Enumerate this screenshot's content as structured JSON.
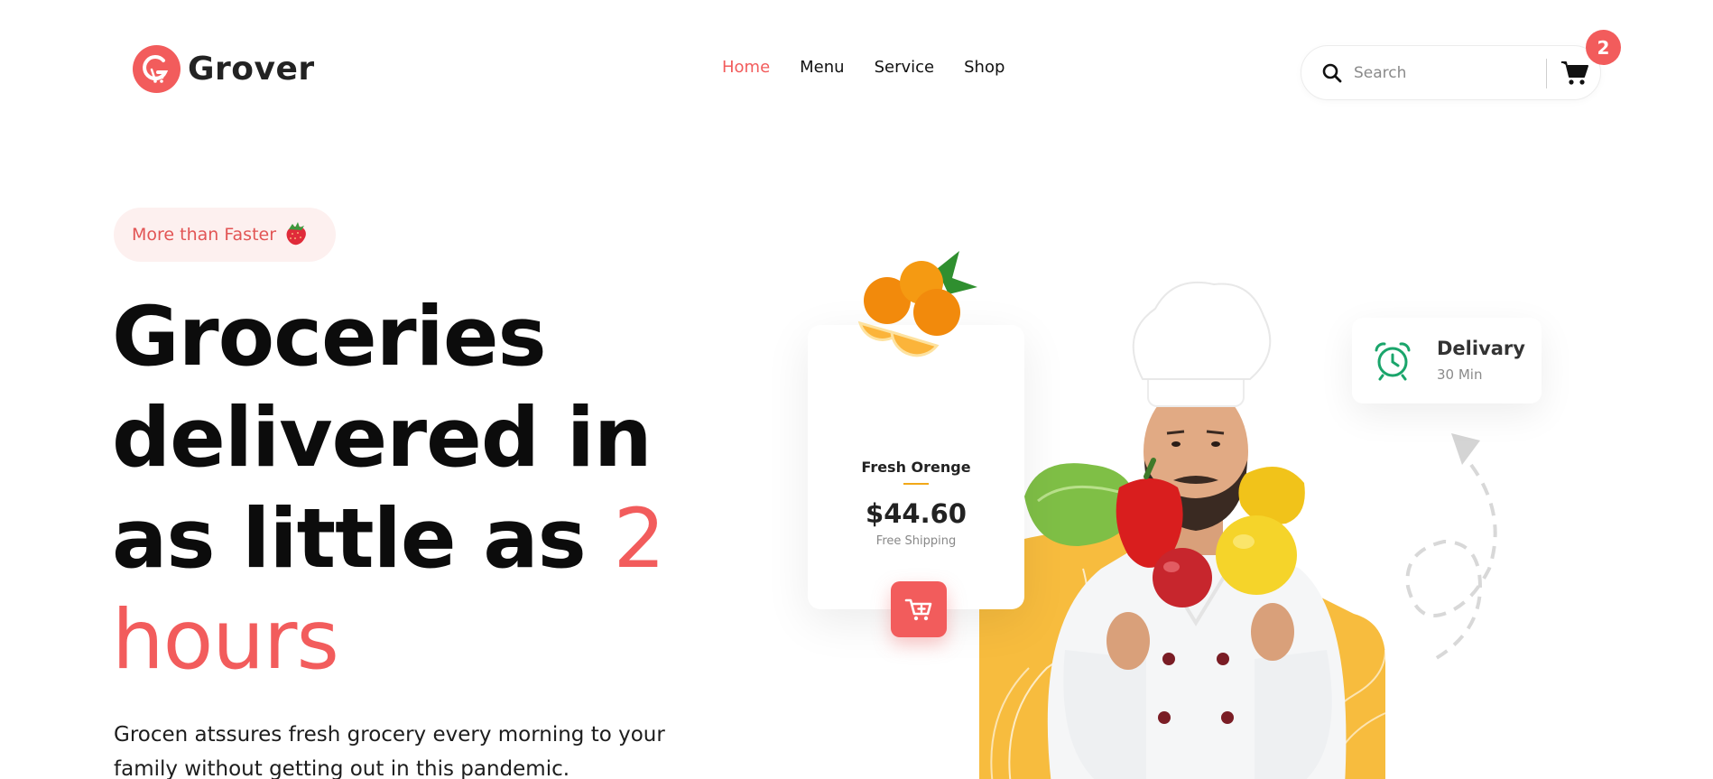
{
  "brand": {
    "name": "Grover",
    "accent_color": "#f25c5c",
    "logo_icon": "grover-g-cart-icon"
  },
  "nav": {
    "items": [
      {
        "label": "Home",
        "active": true
      },
      {
        "label": "Menu",
        "active": false
      },
      {
        "label": "Service",
        "active": false
      },
      {
        "label": "Shop",
        "active": false
      }
    ]
  },
  "search": {
    "placeholder": "Search",
    "value": "",
    "icon": "search-icon"
  },
  "cart": {
    "count": "2",
    "icon": "cart-icon"
  },
  "hero": {
    "tagline": "More than Faster",
    "tagline_icon": "strawberry-icon",
    "headline": {
      "line1": "Groceries",
      "line2": "delivered in",
      "line3_pre": "as little as ",
      "line3_accent": "2",
      "line4_accent": "hours"
    },
    "description": "Grocen atssures fresh grocery every morning to your family without getting out in this pandemic."
  },
  "product_card": {
    "name": "Fresh Orenge",
    "price": "$44.60",
    "shipping": "Free Shipping",
    "icon": "oranges-image",
    "button_icon": "add-to-cart-icon"
  },
  "delivery_card": {
    "title": "Delivary",
    "time": "30 Min",
    "icon": "alarm-clock-icon",
    "icon_color": "#1aa56b"
  },
  "colors": {
    "accent": "#f25c5c",
    "blob": "#f7bc3e",
    "text": "#111111"
  }
}
